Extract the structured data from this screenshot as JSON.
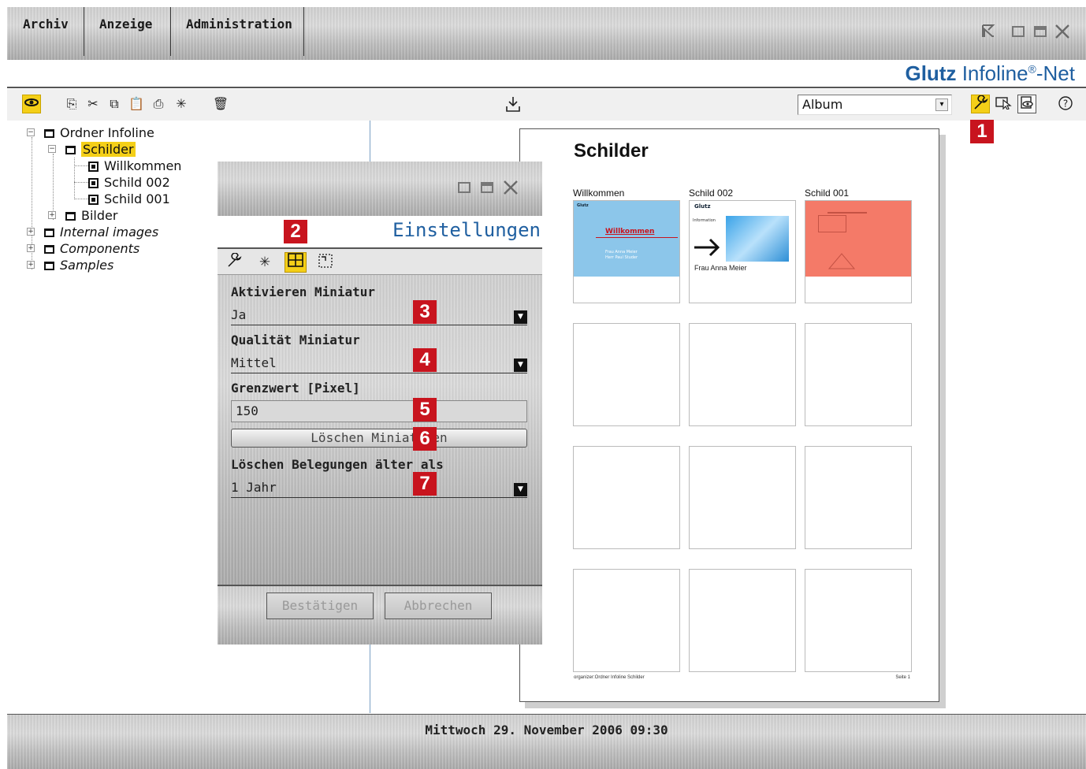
{
  "menu": {
    "tabs": [
      {
        "label": "Archiv"
      },
      {
        "label": "Anzeige"
      },
      {
        "label": "Administration"
      }
    ]
  },
  "logo": {
    "brand": "Glutz",
    "product": "Infoline",
    "registered": "®",
    "suffix": "-Net"
  },
  "toolbar": {
    "album_select_value": "Album"
  },
  "tree": {
    "items": [
      {
        "label": "Ordner Infoline"
      },
      {
        "label": "Schilder"
      },
      {
        "label": "Willkommen"
      },
      {
        "label": "Schild 002"
      },
      {
        "label": "Schild 001"
      },
      {
        "label": "Bilder"
      },
      {
        "label": "Internal images"
      },
      {
        "label": "Components"
      },
      {
        "label": "Samples"
      }
    ]
  },
  "album": {
    "title": "Schilder",
    "thumbs": [
      {
        "label": "Willkommen"
      },
      {
        "label": "Schild 002"
      },
      {
        "label": "Schild 001"
      }
    ],
    "footer_left": "organizer:Ordner Infoline Schilder",
    "footer_right": "Seite 1",
    "thumb1": {
      "brand": "Glutz",
      "heading": "Willkommen",
      "line1": "Frau Anna Meier",
      "line2": "Herr Paul Studer"
    },
    "thumb2": {
      "brand": "Glutz",
      "info": "Information",
      "name": "Frau Anna Meier"
    }
  },
  "dialog": {
    "title": "Einstellungen",
    "fields": {
      "activate_label": "Aktivieren Miniatur",
      "activate_value": "Ja",
      "quality_label": "Qualität Miniatur",
      "quality_value": "Mittel",
      "threshold_label": "Grenzwert [Pixel]",
      "threshold_value": "150",
      "delete_thumbs_button": "Löschen Miniaturen",
      "delete_bookings_label": "Löschen Belegungen älter als",
      "delete_bookings_value": "1 Jahr"
    },
    "confirm_button": "Bestätigen",
    "cancel_button": "Abbrechen"
  },
  "markers": [
    "1",
    "2",
    "3",
    "4",
    "5",
    "6",
    "7"
  ],
  "status": {
    "datetime": "Mittwoch 29. November 2006  09:30"
  },
  "colors": {
    "accent_yellow": "#f4cf18",
    "brand_blue": "#1f5fa0",
    "marker_red": "#c8141e"
  }
}
